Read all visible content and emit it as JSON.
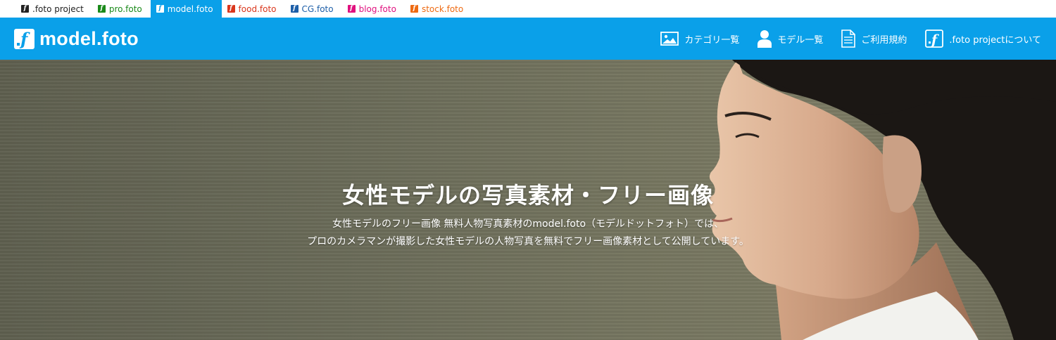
{
  "site_tabs": [
    {
      "label": ".foto project",
      "color": "#222222",
      "icon": "f-logo-icon"
    },
    {
      "label": "pro.foto",
      "color": "#1a8a1a",
      "icon": "f-logo-icon"
    },
    {
      "label": "model.foto",
      "color": "#0aa0e9",
      "icon": "f-logo-icon",
      "active": true
    },
    {
      "label": "food.foto",
      "color": "#d9361c",
      "icon": "f-logo-icon"
    },
    {
      "label": "CG.foto",
      "color": "#1d5fa8",
      "icon": "f-logo-icon"
    },
    {
      "label": "blog.foto",
      "color": "#e0107e",
      "icon": "f-logo-icon"
    },
    {
      "label": "stock.foto",
      "color": "#ee6a12",
      "icon": "f-logo-icon"
    }
  ],
  "header": {
    "brand_color": "#0aa0e9",
    "logo_text": "model.foto",
    "nav": [
      {
        "label": "カテゴリ一覧",
        "icon": "image-icon"
      },
      {
        "label": "モデル一覧",
        "icon": "person-icon"
      },
      {
        "label": "ご利用規約",
        "icon": "document-icon"
      },
      {
        "label": ".foto projectについて",
        "icon": "f-logo-icon"
      }
    ]
  },
  "hero": {
    "title": "女性モデルの写真素材・フリー画像",
    "desc_line1": "女性モデルのフリー画像 無料人物写真素材のmodel.foto（モデルドットフォト）では、",
    "desc_line2": "プロのカメラマンが撮影した女性モデルの人物写真を無料でフリー画像素材として公開しています。"
  }
}
